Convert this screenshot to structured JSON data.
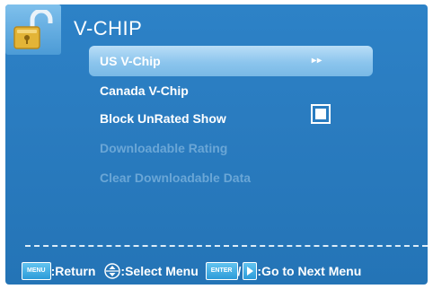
{
  "header": {
    "title": "V-CHIP",
    "icon": "padlock-icon"
  },
  "menu": {
    "items": [
      {
        "label": "US V-Chip",
        "state": "selected",
        "indicator": "▸▸"
      },
      {
        "label": "Canada V-Chip",
        "state": "enabled"
      },
      {
        "label": "Block UnRated Show",
        "state": "enabled",
        "checked": true
      },
      {
        "label": "Downloadable Rating",
        "state": "disabled"
      },
      {
        "label": "Clear Downloadable Data",
        "state": "disabled"
      }
    ]
  },
  "footer": {
    "menu_key": "MENU",
    "return_label": ":Return",
    "select_label": ":Select Menu",
    "enter_key": "ENTER",
    "slash": "/",
    "next_label": ":Go to Next Menu"
  },
  "colors": {
    "background": "#2a7cc0",
    "selected_highlight": "#8cc5ed",
    "disabled_text": "#6aa6d6",
    "text": "#ffffff"
  }
}
